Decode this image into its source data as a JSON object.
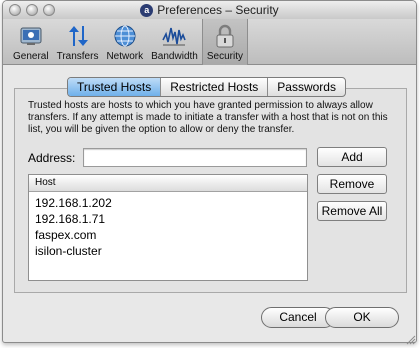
{
  "window": {
    "title": "Preferences – Security"
  },
  "toolbar": {
    "items": [
      {
        "label": "General",
        "icon": "general-icon"
      },
      {
        "label": "Transfers",
        "icon": "transfers-icon"
      },
      {
        "label": "Network",
        "icon": "network-icon"
      },
      {
        "label": "Bandwidth",
        "icon": "bandwidth-icon"
      },
      {
        "label": "Security",
        "icon": "lock-icon",
        "active": true
      }
    ]
  },
  "tabs": [
    {
      "label": "Trusted Hosts",
      "selected": true
    },
    {
      "label": "Restricted Hosts",
      "selected": false
    },
    {
      "label": "Passwords",
      "selected": false
    }
  ],
  "description": "Trusted hosts are hosts to which you have granted permission to always allow transfers.  If any attempt is made to initiate a transfer with a host that is not on this list, you will be given the option to allow or deny the transfer.",
  "address": {
    "label": "Address:",
    "value": "",
    "placeholder": ""
  },
  "buttons": {
    "add": "Add",
    "remove": "Remove",
    "remove_all": "Remove All"
  },
  "hosts_table": {
    "header": "Host",
    "rows": [
      "192.168.1.202",
      "192.168.1.71",
      "faspex.com",
      "isilon-cluster"
    ]
  },
  "footer": {
    "cancel": "Cancel",
    "ok": "OK"
  },
  "colors": {
    "selected_tab": "#7db8ec",
    "window_bg": "#e8e8e8"
  }
}
